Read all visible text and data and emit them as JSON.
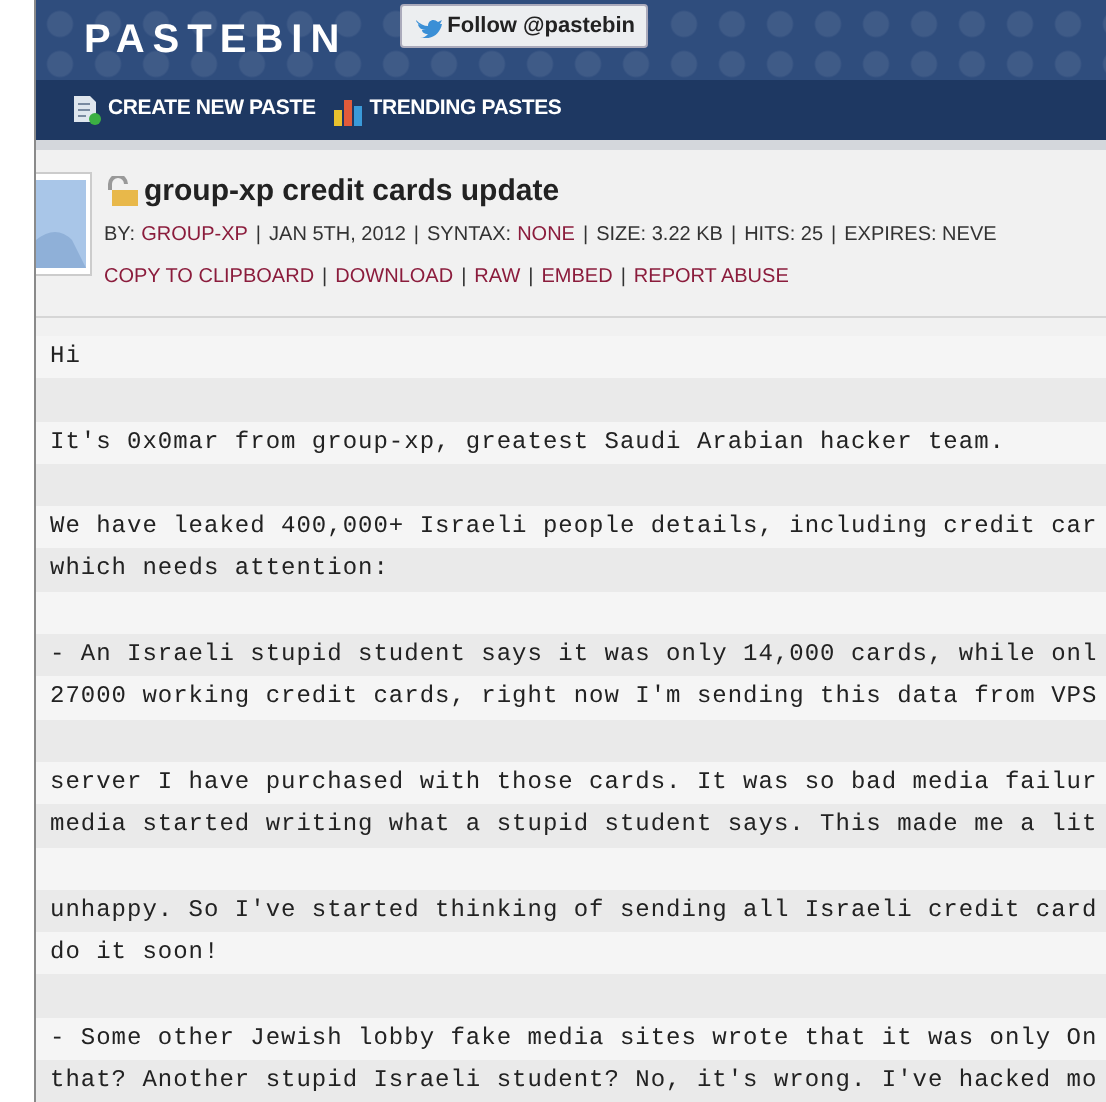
{
  "header": {
    "logo": "PASTEBIN",
    "follow_button": "Follow @pastebin"
  },
  "nav": [
    {
      "label": "CREATE NEW PASTE",
      "kind": "new"
    },
    {
      "label": "TRENDING PASTES",
      "kind": "trending"
    }
  ],
  "paste": {
    "title": "group-xp credit cards update",
    "separator": "|",
    "meta": [
      {
        "text": "BY:",
        "value": "GROUP-XP"
      },
      {
        "text": "JAN 5TH, 2012"
      },
      {
        "text": "SYNTAX:",
        "value": "NONE"
      },
      {
        "text": "SIZE: 3.22 KB"
      },
      {
        "text": "HITS: 25"
      },
      {
        "text": "EXPIRES: NEVE"
      }
    ],
    "actions": [
      "COPY TO CLIPBOARD",
      "DOWNLOAD",
      "RAW",
      "EMBED",
      "REPORT ABUSE"
    ]
  },
  "paragraphs": [
    [
      "Hi"
    ],
    [
      "It's 0x0mar from group-xp, greatest Saudi Arabian hacker team."
    ],
    [
      "We have leaked 400,000+ Israeli people details, including credit car",
      "which needs attention:"
    ],
    [
      "- An Israeli stupid student says it was only 14,000 cards, while onl",
      "27000 working credit cards, right now I'm sending this data from VPS"
    ],
    [
      "server I have purchased with those cards. It was so bad media failur",
      "media started writing what a stupid student says. This made me a lit"
    ],
    [
      "unhappy. So I've started thinking of sending all Israeli credit card",
      "do it soon!"
    ],
    [
      "- Some other Jewish lobby fake media sites wrote that it was only On",
      "that? Another stupid Israeli student? No, it's wrong. I've hacked mo"
    ]
  ]
}
